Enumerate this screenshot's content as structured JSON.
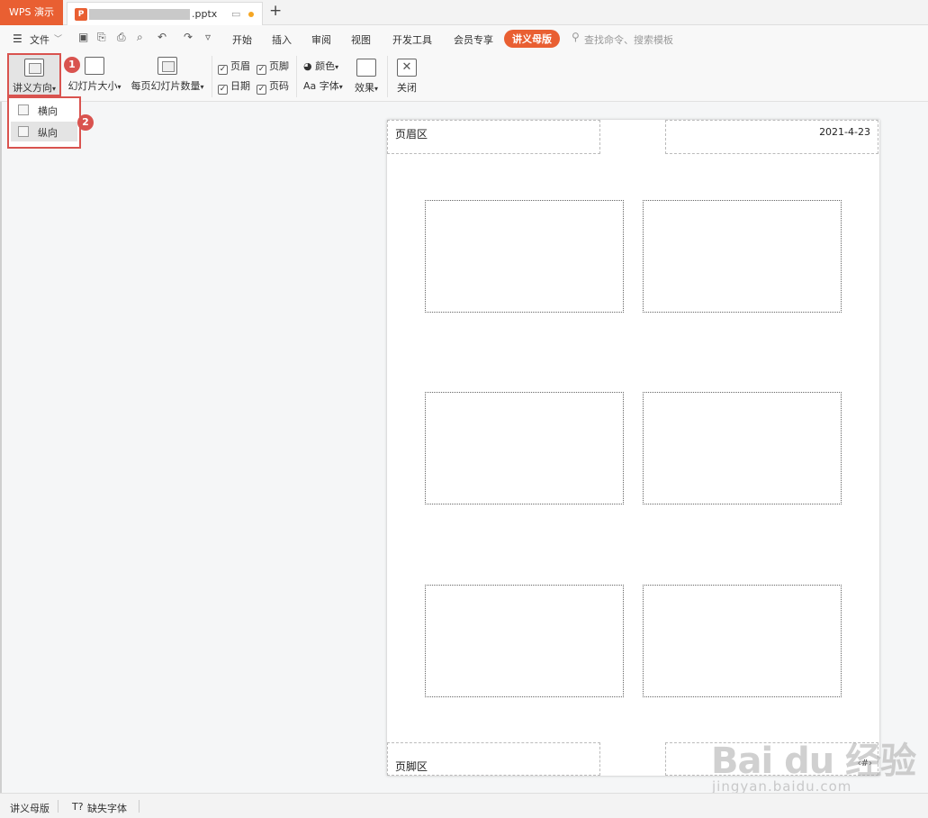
{
  "titlebar": {
    "app_tab": "WPS 演示",
    "doc_name": ".pptx",
    "doc_icon": "P",
    "add_tab": "+"
  },
  "menubar": {
    "menu_icon": "☰",
    "file": "文件",
    "file_arrow": "﹀",
    "tabs": [
      "开始",
      "插入",
      "审阅",
      "视图",
      "开发工具",
      "会员专享",
      "讲义母版"
    ],
    "active_tab": "讲义母版",
    "search_placeholder": "查找命令、搜索模板"
  },
  "ribbon": {
    "orientation": "讲义方向",
    "slide_size": "幻灯片大小",
    "per_page": "每页幻灯片数量",
    "header": "页眉",
    "footer": "页脚",
    "date": "日期",
    "page_number": "页码",
    "colors": "颜色",
    "fonts": "字体",
    "fonts_prefix": "Aa",
    "effects": "效果",
    "close": "关闭",
    "check": "✓",
    "arrow": "▾",
    "marker1": "1",
    "marker2": "2"
  },
  "dropdown": {
    "items": [
      "横向",
      "纵向"
    ],
    "selected": "纵向"
  },
  "page": {
    "header_text": "页眉区",
    "date_text": "2021-4-23",
    "footer_text": "页脚区",
    "page_number_text": "‹#›"
  },
  "statusbar": {
    "mode": "讲义母版",
    "missing_fonts_icon": "T?",
    "missing_fonts": "缺失字体"
  },
  "watermark": {
    "main": "Bai du 经验",
    "sub": "jingyan.baidu.com"
  },
  "colors": {
    "accent": "#e95f32",
    "highlight_red": "#d9534f"
  }
}
